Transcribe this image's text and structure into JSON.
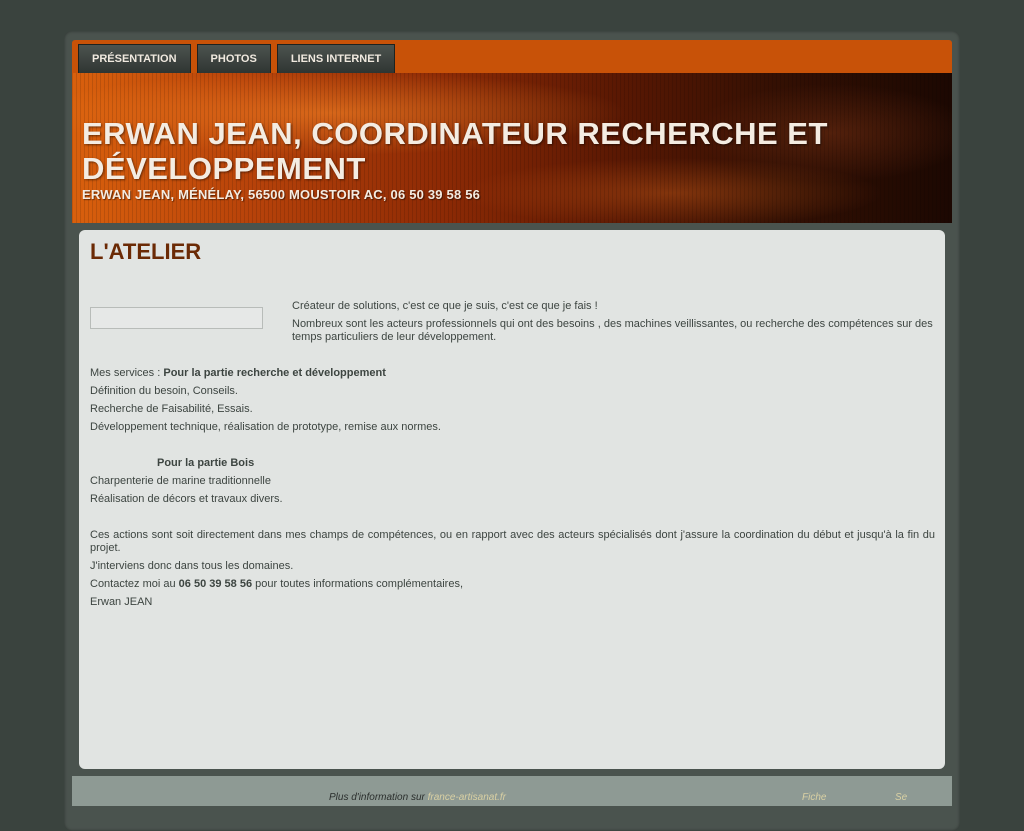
{
  "nav": {
    "items": [
      {
        "label": "PRÉSENTATION"
      },
      {
        "label": "PHOTOS"
      },
      {
        "label": "LIENS INTERNET"
      }
    ]
  },
  "banner": {
    "title": "ERWAN JEAN, COORDINATEUR RECHERCHE ET DÉVELOPPEMENT",
    "subtitle": "ERWAN JEAN, MÉNÉLAY, 56500 MOUSTOIR AC, 06 50 39 58 56"
  },
  "content": {
    "title": "L'ATELIER",
    "intro": [
      "Créateur de solutions, c'est ce que je suis, c'est ce que je fais !",
      "Nombreux sont les acteurs professionnels qui ont des besoins , des machines veillissantes, ou recherche des compétences sur des temps particuliers de leur développement."
    ],
    "services_prefix": "Mes services : ",
    "services_rd_label": "Pour la partie recherche et développement",
    "rd_lines": [
      "Définition du besoin, Conseils.",
      "Recherche de Faisabilité, Essais.",
      "Développement technique, réalisation de prototype, remise aux normes."
    ],
    "bois_label": "Pour la partie Bois",
    "bois_lines": [
      "Charpenterie de marine traditionnelle",
      "Réalisation de décors et travaux divers."
    ],
    "actions_text": "Ces actions sont soit directement dans mes champs de compétences, ou en rapport avec des acteurs spécialisés dont j'assure la coordination du début et jusqu'à la fin du projet.",
    "domains_text": "J'interviens donc dans tous les domaines.",
    "contact_prefix": "Contactez moi au ",
    "contact_phone": "06 50 39 58 56",
    "contact_suffix": " pour toutes informations complémentaires,",
    "signature": "Erwan JEAN"
  },
  "footer": {
    "info_prefix": "Plus d'information sur ",
    "info_link": "france-artisanat.fr",
    "fiche": "Fiche",
    "se": "Se"
  },
  "colors": {
    "nav_bar": "#c85208",
    "title": "#6b2a05",
    "background": "#3a433e",
    "content_bg": "#e1e4e2"
  }
}
